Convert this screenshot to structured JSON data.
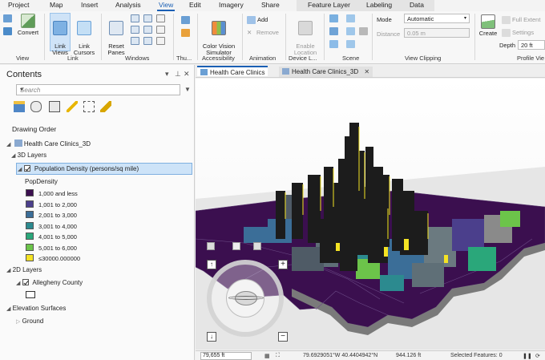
{
  "menu": {
    "tabs": [
      "Project",
      "Map",
      "Insert",
      "Analysis",
      "View",
      "Edit",
      "Imagery",
      "Share",
      "Feature Layer",
      "Labeling",
      "Data"
    ],
    "active": "View"
  },
  "ribbon": {
    "view_group": {
      "convert_label": "Convert",
      "group_label": "View"
    },
    "link_group": {
      "link_views_label": "Link\nViews",
      "link_cursors_label": "Link\nCursors",
      "group_label": "Link"
    },
    "windows_group": {
      "reset_panes_label": "Reset\nPanes",
      "group_label": "Windows"
    },
    "thumb_group": {
      "group_label": "Thu..."
    },
    "accessibility_group": {
      "color_vision_label": "Color Vision\nSimulator",
      "group_label": "Accessibility"
    },
    "animation_group": {
      "add_label": "Add",
      "remove_label": "Remove",
      "group_label": "Animation"
    },
    "device_group": {
      "enable_location_label": "Enable\nLocation",
      "group_label": "Device L..."
    },
    "scene_group": {
      "group_label": "Scene"
    },
    "clipping_group": {
      "mode_label": "Mode",
      "mode_value": "Automatic",
      "distance_label": "Distance",
      "distance_value": "0.05  m",
      "group_label": "View Clipping"
    },
    "profile_group": {
      "create_label": "Create",
      "full_extent_label": "Full Extent",
      "settings_label": "Settings",
      "depth_label": "Depth",
      "depth_value": "20 ft",
      "group_label": "Profile Vie"
    }
  },
  "contents": {
    "title": "Contents",
    "search_placeholder": "Search",
    "drawing_order": "Drawing Order",
    "scene_name": "Health Care Clinics_3D",
    "layers_3d": "3D Layers",
    "density_layer": "Population Density (persons/sq mile)",
    "legend_field": "PopDensity",
    "legend": [
      {
        "label": "1,000 and less",
        "color": "#3b0f4f"
      },
      {
        "label": "1,001 to 2,000",
        "color": "#4b3f8c"
      },
      {
        "label": "2,001 to 3,000",
        "color": "#3b6e98"
      },
      {
        "label": "3,001 to 4,000",
        "color": "#2c8a8f"
      },
      {
        "label": "4,001 to 5,000",
        "color": "#2aa77a"
      },
      {
        "label": "5,001 to 6,000",
        "color": "#6cc44a"
      },
      {
        "label": "≤30000.000000",
        "color": "#f4e324"
      }
    ],
    "layers_2d": "2D Layers",
    "county_layer": "Allegheny County",
    "elevation_surfaces": "Elevation Surfaces",
    "ground": "Ground"
  },
  "map_tabs": [
    "Health Care Clinics",
    "Health Care Clinics_3D"
  ],
  "status": {
    "scale": "79,655 ft",
    "coords": "79.6929051°W 40.4404942°N",
    "elevation": "944.126 ft",
    "selected": "Selected Features: 0"
  },
  "colors": {
    "accent": "#1a5fb4",
    "selection": "#cde3f8",
    "building": "#1c1c1c",
    "ground": "#3b0f4f"
  }
}
